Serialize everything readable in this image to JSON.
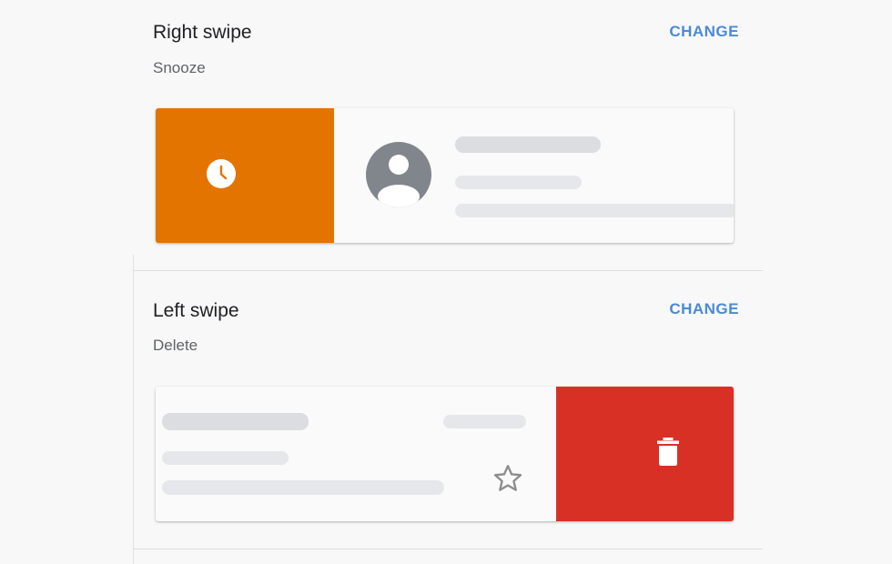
{
  "right_swipe": {
    "title": "Right swipe",
    "action": "Snooze",
    "change_label": "CHANGE",
    "action_color": "#e37400",
    "action_icon": "clock-icon"
  },
  "left_swipe": {
    "title": "Left swipe",
    "action": "Delete",
    "change_label": "CHANGE",
    "action_color": "#d93025",
    "action_icon": "trash-icon"
  },
  "colors": {
    "accent": "#4a8ad6",
    "avatar": "#80868b"
  }
}
